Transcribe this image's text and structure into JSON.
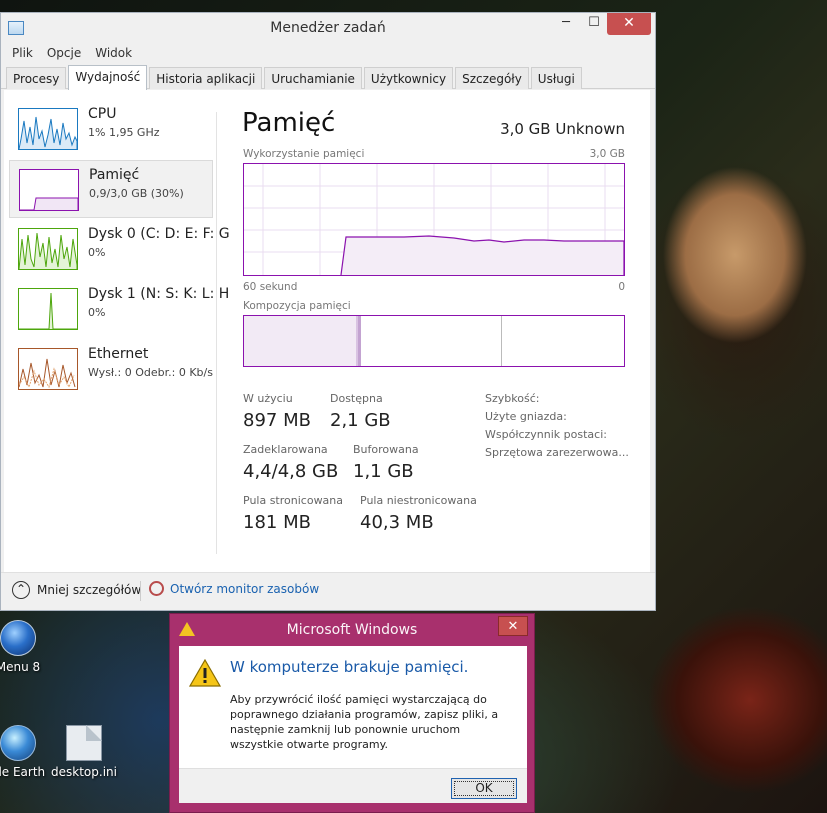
{
  "desktop": {
    "icons": [
      {
        "label": "Menu 8",
        "icon": "windows-orb-icon"
      },
      {
        "label": "gle Earth",
        "icon": "google-earth-icon"
      },
      {
        "label": "desktop.ini",
        "icon": "ini-file-icon"
      }
    ]
  },
  "task_manager": {
    "title": "Menedżer zadań",
    "window_buttons": {
      "minimize": "─",
      "maximize": "☐",
      "close": "✕"
    },
    "menu": [
      "Plik",
      "Opcje",
      "Widok"
    ],
    "tabs": [
      "Procesy",
      "Wydajność",
      "Historia aplikacji",
      "Uruchamianie",
      "Użytkownicy",
      "Szczegóły",
      "Usługi"
    ],
    "active_tab": "Wydajność",
    "sidebar": [
      {
        "name": "CPU",
        "sub": "1% 1,95 GHz",
        "color": "#1a79c0"
      },
      {
        "name": "Pamięć",
        "sub": "0,9/3,0 GB (30%)",
        "color": "#8b12ae"
      },
      {
        "name": "Dysk 0 (C: D: E: F: G",
        "sub": "0%",
        "color": "#4da60c"
      },
      {
        "name": "Dysk 1 (N: S: K: L: H",
        "sub": "0%",
        "color": "#4da60c"
      },
      {
        "name": "Ethernet",
        "sub": "Wysł.: 0 Odebr.: 0 Kb/s",
        "color": "#a7572a"
      }
    ],
    "memory": {
      "title": "Pamięć",
      "total": "3,0 GB Unknown",
      "usage_label": "Wykorzystanie pamięci",
      "usage_max": "3,0 GB",
      "time_left": "60 sekund",
      "time_right": "0",
      "composition_label": "Kompozycja pamięci",
      "stats": {
        "in_use_label": "W użyciu",
        "in_use": "897 MB",
        "available_label": "Dostępna",
        "available": "2,1 GB",
        "committed_label": "Zadeklarowana",
        "committed": "4,4/4,8 GB",
        "cached_label": "Buforowana",
        "cached": "1,1 GB",
        "paged_label": "Pula stronicowana",
        "paged": "181 MB",
        "nonpaged_label": "Pula niestronicowana",
        "nonpaged": "40,3 MB"
      },
      "specs": [
        "Szybkość:",
        "Użyte gniazda:",
        "Współczynnik postaci:",
        "Sprzętowa zarezerwowa..."
      ],
      "usage_fraction": 0.3
    },
    "footer": {
      "less_details": "Mniej szczegółów",
      "resource_monitor": "Otwórz monitor zasobów"
    }
  },
  "dialog": {
    "title": "Microsoft Windows",
    "close": "✕",
    "heading": "W komputerze brakuje pamięci.",
    "message": "Aby przywrócić ilość pamięci wystarczającą do poprawnego działania programów, zapisz pliki, a następnie zamknij lub ponownie uruchom wszystkie otwarte programy.",
    "ok": "OK"
  }
}
